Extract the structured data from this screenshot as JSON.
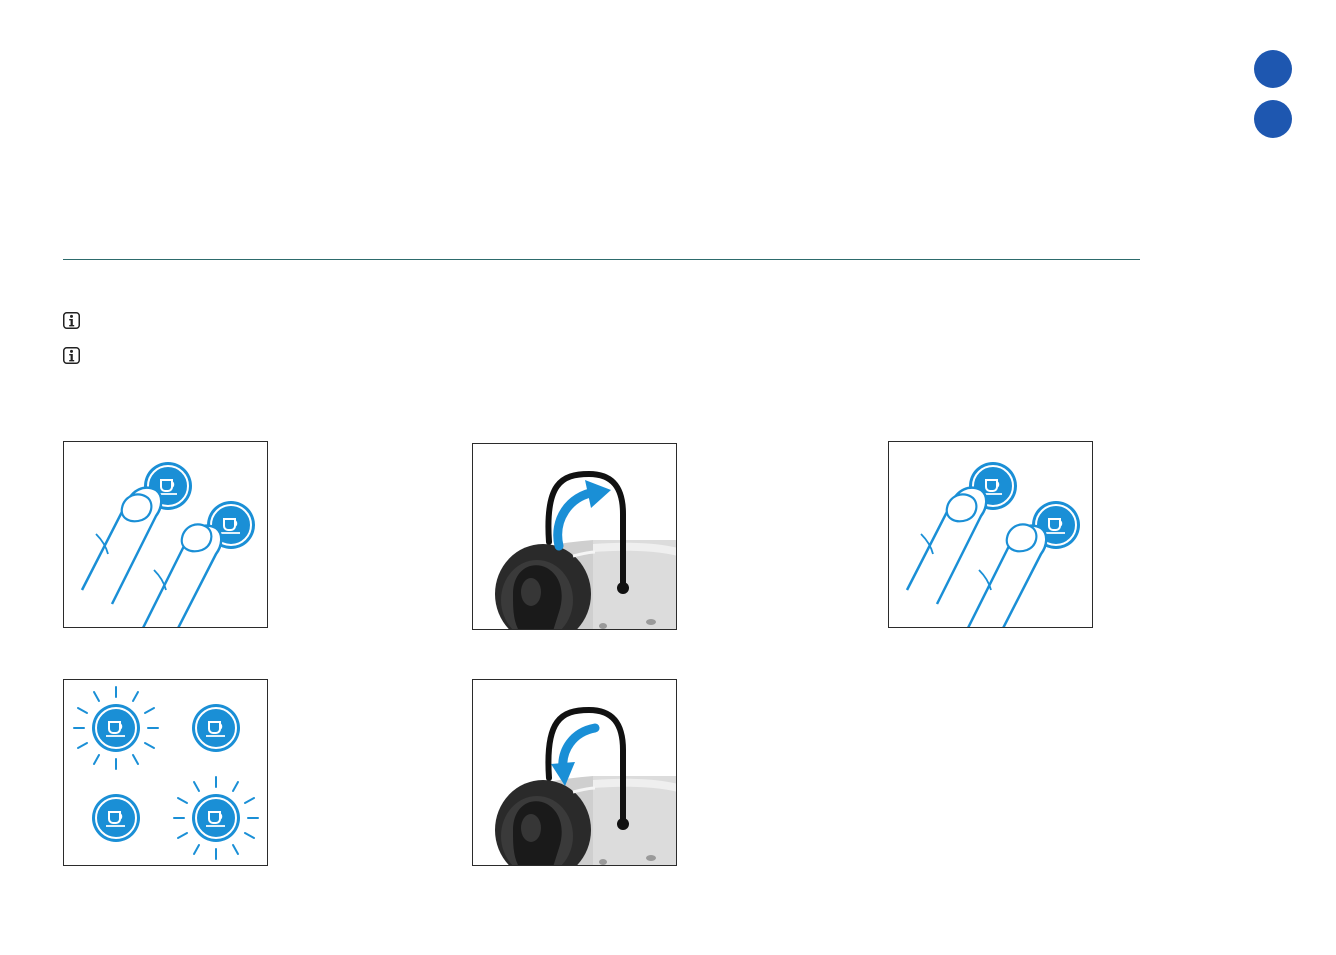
{
  "nav": {
    "dots": [
      "section-dot-1",
      "section-dot-2"
    ]
  },
  "notes": {
    "icons": [
      "info-icon",
      "info-icon"
    ]
  },
  "figures": [
    {
      "name": "press-both-buttons-figure-1",
      "icon": "fingers-press-buttons-icon"
    },
    {
      "name": "lever-open-figure",
      "icon": "lever-arrow-up-icon"
    },
    {
      "name": "press-both-buttons-figure-2",
      "icon": "fingers-press-buttons-icon"
    },
    {
      "name": "blinking-buttons-figure",
      "icon": "blinking-buttons-icon"
    },
    {
      "name": "lever-close-figure",
      "icon": "lever-arrow-down-icon"
    }
  ],
  "colors": {
    "nav_dot": "#1e57b0",
    "accent_blue": "#1a8fd6",
    "rule": "#2d6b6c",
    "frame": "#2b2b2b"
  }
}
